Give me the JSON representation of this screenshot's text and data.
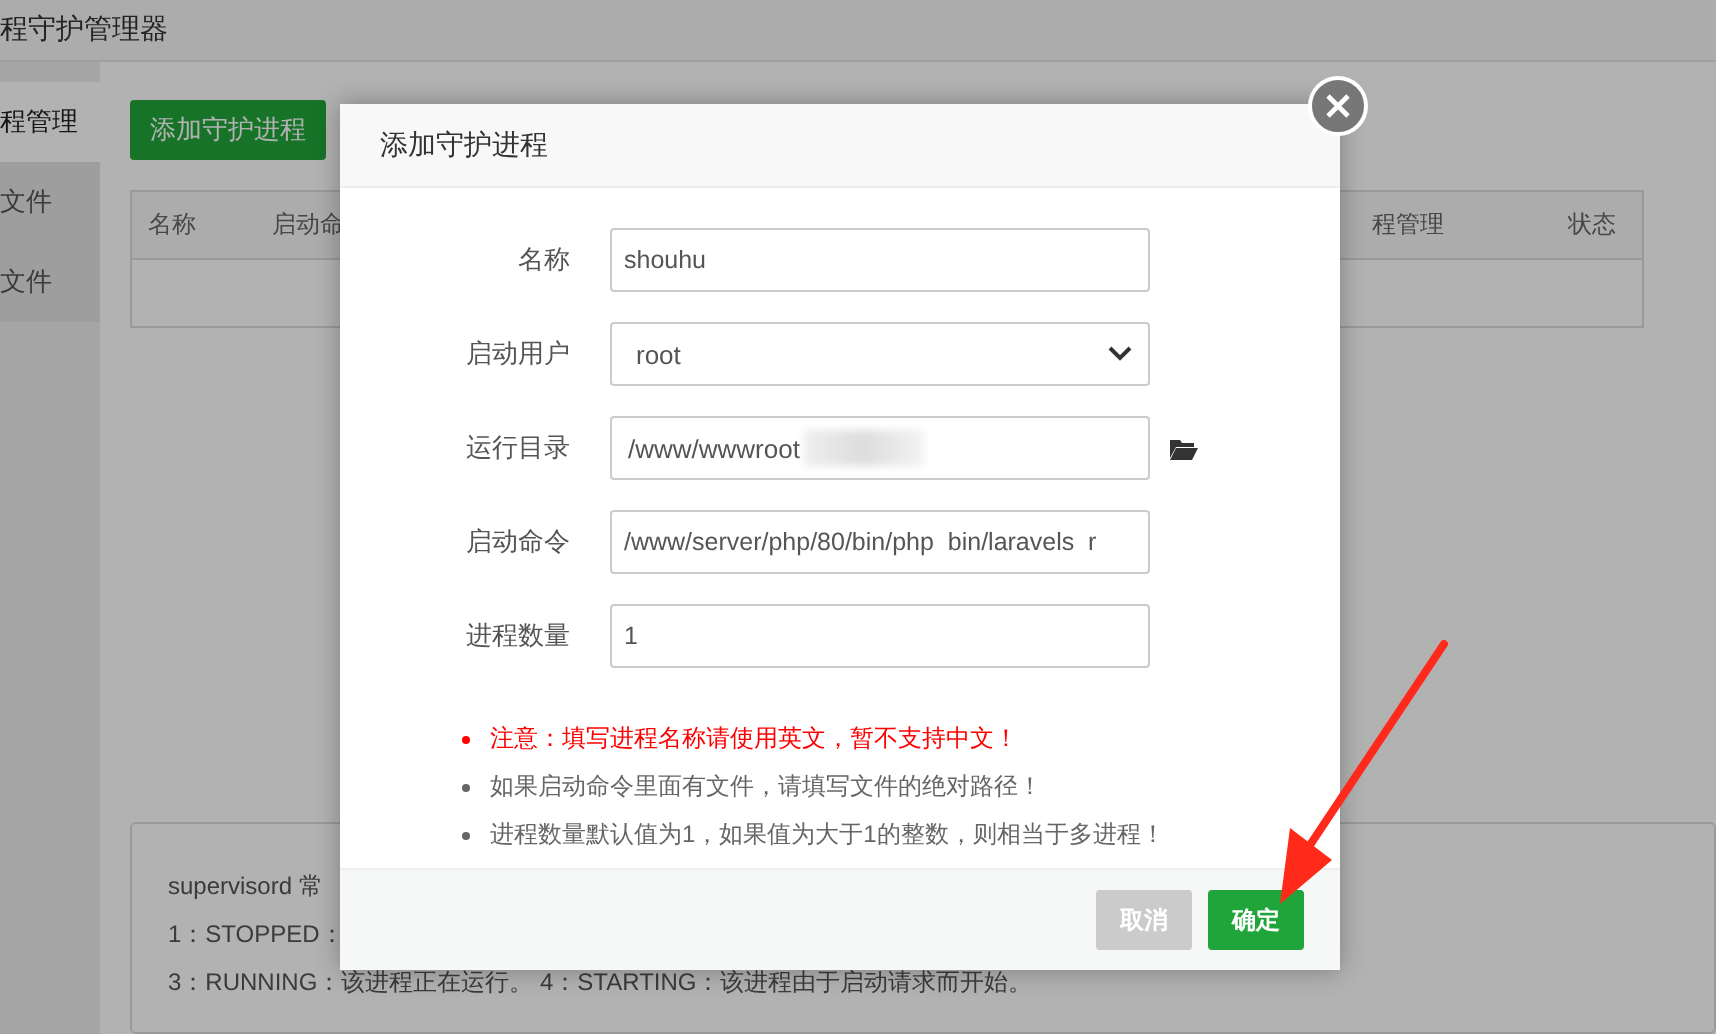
{
  "window": {
    "title": "程守护管理器"
  },
  "sidebar": {
    "items": [
      {
        "label": "程管理",
        "selected": true
      },
      {
        "label": "文件",
        "selected": false
      },
      {
        "label": "文件",
        "selected": false
      }
    ]
  },
  "toolbar": {
    "add_button": "添加守护进程"
  },
  "table": {
    "columns": [
      "名称",
      "启动命",
      "程管理",
      "状态"
    ]
  },
  "info_panel": {
    "lines": [
      "supervisord 常",
      "1：STOPPED：",
      "3：RUNNING：该进程正在运行。 4：STARTING：该进程由于启动请求而开始。"
    ]
  },
  "dialog": {
    "title": "添加守护进程",
    "fields": [
      {
        "kind": "text",
        "label": "名称",
        "value": "shouhu"
      },
      {
        "kind": "select",
        "label": "启动用户",
        "value": "root"
      },
      {
        "kind": "path",
        "label": "运行目录",
        "value": "/www/wwwroot"
      },
      {
        "kind": "text",
        "label": "启动命令",
        "value": "/www/server/php/80/bin/php  bin/laravels  r"
      },
      {
        "kind": "text",
        "label": "进程数量",
        "value": "1"
      }
    ],
    "notes": [
      {
        "kind": "warning",
        "text": "注意：填写进程名称请使用英文，暂不支持中文！"
      },
      {
        "kind": "info",
        "text": "如果启动命令里面有文件，请填写文件的绝对路径！"
      },
      {
        "kind": "info",
        "text": "进程数量默认值为1，如果值为大于1的整数，则相当于多进程！"
      }
    ],
    "buttons": [
      {
        "kind": "cancel",
        "label": "取消"
      },
      {
        "kind": "confirm",
        "label": "确定"
      }
    ]
  }
}
